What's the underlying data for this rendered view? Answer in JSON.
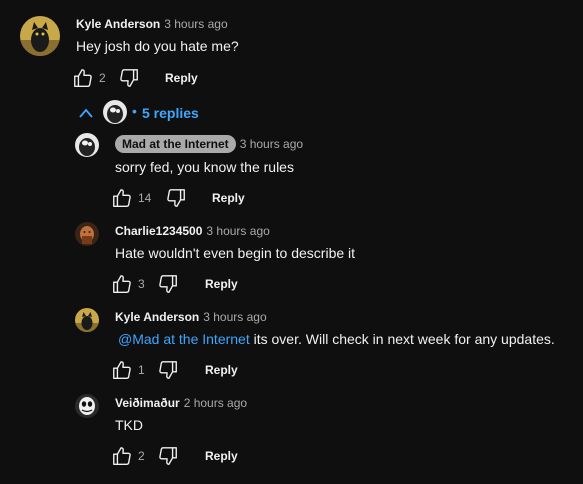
{
  "comments": [
    {
      "author": "Kyle Anderson",
      "time": "3 hours ago",
      "text": "Hey josh do you hate me?",
      "likes": "2",
      "reply": "Reply"
    },
    {
      "author": "Mad at the Internet",
      "time": "3 hours ago",
      "text": "sorry fed, you know the rules",
      "likes": "14",
      "reply": "Reply"
    },
    {
      "author": "Charlie1234500",
      "time": "3 hours ago",
      "text": "Hate wouldn't even begin to describe it",
      "likes": "3",
      "reply": "Reply"
    },
    {
      "author": "Kyle Anderson",
      "time": "3 hours ago",
      "mention": "@Mad at the Internet",
      "text": " its over. Will check in next week for any updates.",
      "likes": "1",
      "reply": "Reply"
    },
    {
      "author": "Veiðimaður",
      "time": "2 hours ago",
      "text": "TKD",
      "likes": "2",
      "reply": "Reply"
    }
  ],
  "replies_toggle": {
    "dot": "•",
    "label": "5 replies"
  },
  "icons": {
    "like": "thumbs-up-icon",
    "dislike": "thumbs-down-icon",
    "toggle": "chevron-up-icon"
  },
  "colors": {
    "background": "#0f0f0f",
    "link": "#3ea6ff",
    "pill": "#aaaaaa"
  }
}
